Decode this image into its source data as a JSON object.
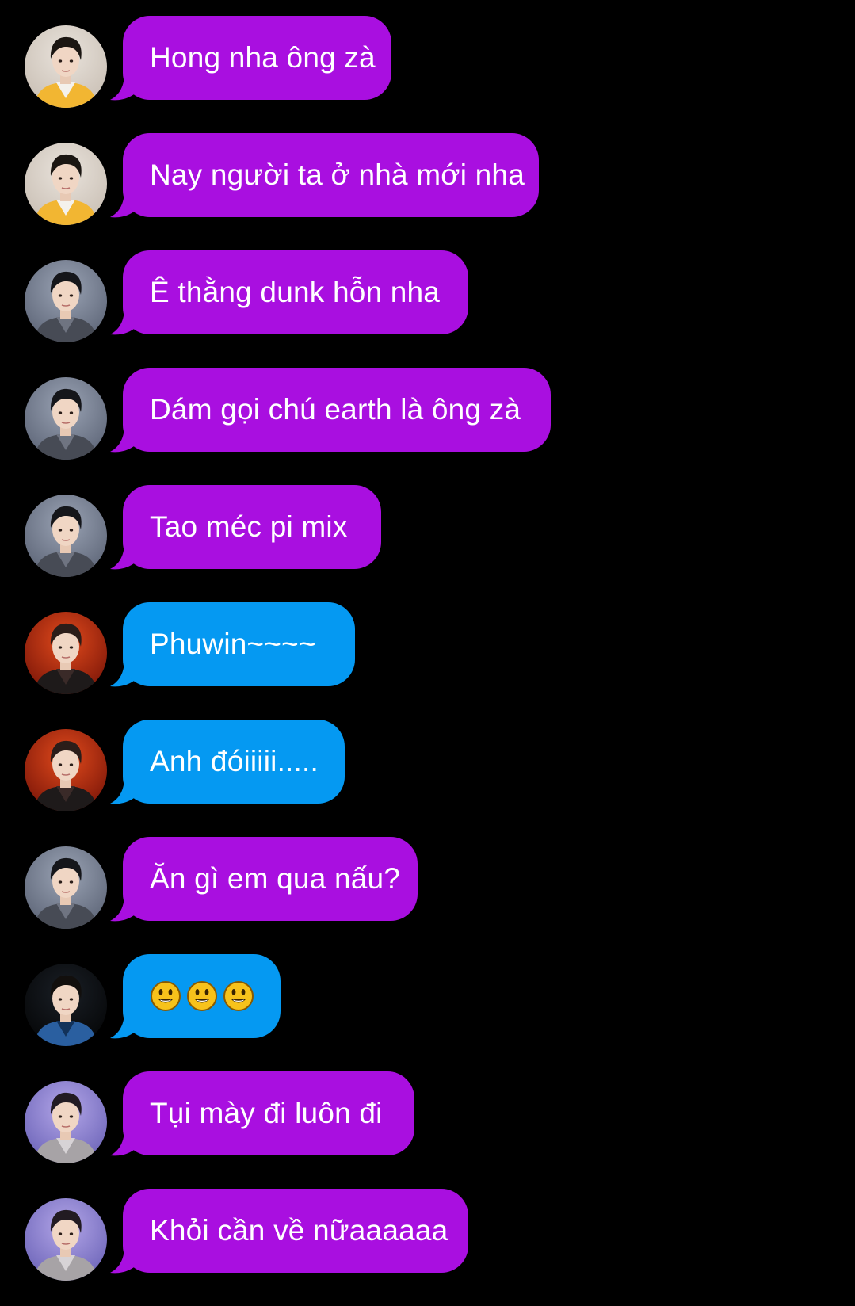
{
  "colors": {
    "background": "#000000",
    "purple_bubble": "#a90fe0",
    "blue_bubble": "#0599f2",
    "text": "#ffffff"
  },
  "messages": [
    {
      "avatar": "yellow-jacket-avatar",
      "bubble_color": "purple",
      "text": "Hong nha ông zà"
    },
    {
      "avatar": "yellow-jacket-avatar",
      "bubble_color": "purple",
      "text": "Nay người ta ở nhà mới nha"
    },
    {
      "avatar": "gray-jacket-avatar",
      "bubble_color": "purple",
      "text": "Ê thằng dunk hỗn nha"
    },
    {
      "avatar": "gray-jacket-avatar",
      "bubble_color": "purple",
      "text": "Dám gọi chú earth là ông zà"
    },
    {
      "avatar": "gray-jacket-avatar",
      "bubble_color": "purple",
      "text": "Tao méc pi mix"
    },
    {
      "avatar": "red-stage-avatar",
      "bubble_color": "blue",
      "text": "Phuwin~~~~"
    },
    {
      "avatar": "red-stage-avatar",
      "bubble_color": "blue",
      "text": "Anh đóiiiii....."
    },
    {
      "avatar": "gray-jacket-avatar",
      "bubble_color": "purple",
      "text": "Ăn gì em qua nấu?"
    },
    {
      "avatar": "dark-blue-shirt-avatar",
      "bubble_color": "blue",
      "emoji": [
        "smiley-face-icon",
        "smiley-face-icon",
        "smiley-face-icon"
      ]
    },
    {
      "avatar": "purple-stage-avatar",
      "bubble_color": "purple",
      "text": "Tụi mày đi luôn đi"
    },
    {
      "avatar": "purple-stage-avatar",
      "bubble_color": "purple",
      "text": "Khỏi cần về nữaaaaaa"
    }
  ]
}
